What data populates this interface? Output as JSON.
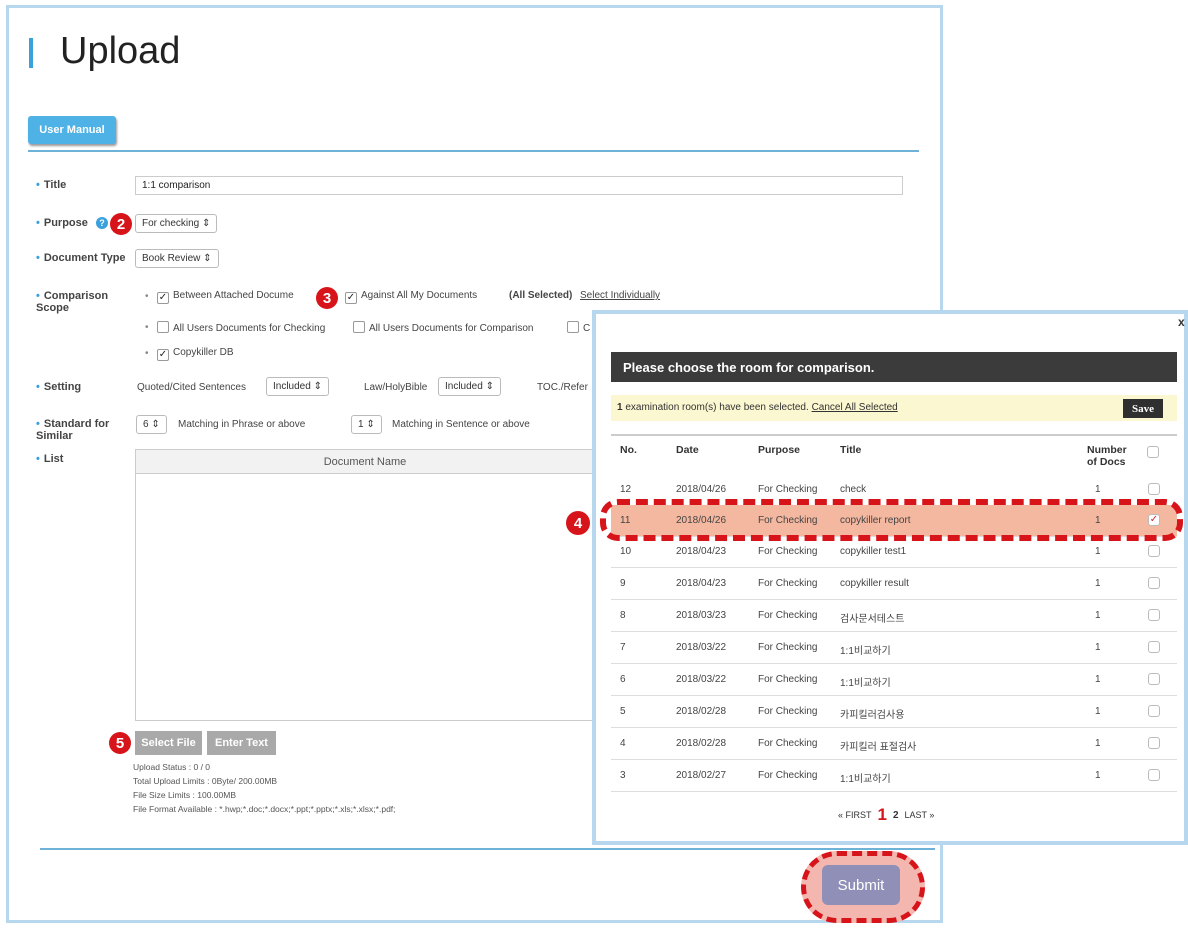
{
  "page": {
    "title": "Upload",
    "user_manual": "User Manual"
  },
  "form": {
    "title_label": "Title",
    "title_value": "1:1 comparison",
    "purpose_label": "Purpose",
    "purpose_value": "For checking",
    "help_icon": "?",
    "doctype_label": "Document Type",
    "doctype_value": "Book Review",
    "scope_label": "Comparison Scope",
    "scope_row1": [
      "Between Attached Docume",
      "Against All My Documents"
    ],
    "scope_all_selected": "(All Selected)",
    "scope_select_individually": "Select Individually",
    "scope_row2": [
      "All Users Documents for Checking",
      "All Users Documents for Comparison",
      "C"
    ],
    "scope_row3": "Copykiller DB",
    "setting_label": "Setting",
    "setting_quoted": "Quoted/Cited Sentences",
    "setting_quoted_value": "Included",
    "setting_law": "Law/HolyBible",
    "setting_law_value": "Included",
    "setting_toc": "TOC./Refer",
    "standard_label": "Standard for Similar",
    "standard_phrase_value": "6",
    "standard_phrase_text": "Matching in Phrase or above",
    "standard_sentence_value": "1",
    "standard_sentence_text": "Matching in Sentence or above",
    "list_label": "List",
    "list_header": "Document Name",
    "select_file": "Select File",
    "enter_text": "Enter Text",
    "upload_status": "Upload Status : 0 / 0",
    "total_limits": "Total Upload Limits : 0Byte/ 200.00MB",
    "file_size_limits": "File Size Limits : 100.00MB",
    "file_format": "File Format Available : *.hwp;*.doc;*.docx;*.ppt;*.pptx;*.xls;*.xlsx;*.pdf;",
    "submit": "Submit"
  },
  "badges": {
    "b2": "2",
    "b3": "3",
    "b4": "4",
    "b5": "5"
  },
  "modal": {
    "close": "x",
    "header": "Please choose the room for comparison.",
    "selected_count": "1",
    "selected_text": "examination room(s) have been selected.",
    "cancel_all": "Cancel All Selected",
    "save": "Save",
    "columns": {
      "no": "No.",
      "date": "Date",
      "purpose": "Purpose",
      "title": "Title",
      "docs": "Number of Docs"
    },
    "rows": [
      {
        "no": "12",
        "date": "2018/04/26",
        "purpose": "For Checking",
        "title": "check",
        "docs": "1",
        "checked": ""
      },
      {
        "no": "11",
        "date": "2018/04/26",
        "purpose": "For Checking",
        "title": "copykiller report",
        "docs": "1",
        "checked": "✓"
      },
      {
        "no": "10",
        "date": "2018/04/23",
        "purpose": "For Checking",
        "title": "copykiller test1",
        "docs": "1",
        "checked": ""
      },
      {
        "no": "9",
        "date": "2018/04/23",
        "purpose": "For Checking",
        "title": "copykiller result",
        "docs": "1",
        "checked": ""
      },
      {
        "no": "8",
        "date": "2018/03/23",
        "purpose": "For Checking",
        "title": "검사문서테스트",
        "docs": "1",
        "checked": ""
      },
      {
        "no": "7",
        "date": "2018/03/22",
        "purpose": "For Checking",
        "title": "1:1비교하기",
        "docs": "1",
        "checked": ""
      },
      {
        "no": "6",
        "date": "2018/03/22",
        "purpose": "For Checking",
        "title": "1:1비교하기",
        "docs": "1",
        "checked": ""
      },
      {
        "no": "5",
        "date": "2018/02/28",
        "purpose": "For Checking",
        "title": "카피킬러검사용",
        "docs": "1",
        "checked": ""
      },
      {
        "no": "4",
        "date": "2018/02/28",
        "purpose": "For Checking",
        "title": "카피킬러 표절검사",
        "docs": "1",
        "checked": ""
      },
      {
        "no": "3",
        "date": "2018/02/27",
        "purpose": "For Checking",
        "title": "1:1비교하기",
        "docs": "1",
        "checked": ""
      }
    ],
    "pager": {
      "first": "« FIRST",
      "page1": "1",
      "page2": "2",
      "last": "LAST »"
    }
  },
  "colors": {
    "accent": "#3aa1dc",
    "badge_red": "#d7141a",
    "modal_header": "#3b3b3b",
    "highlight_row": "#f4b7a0"
  }
}
